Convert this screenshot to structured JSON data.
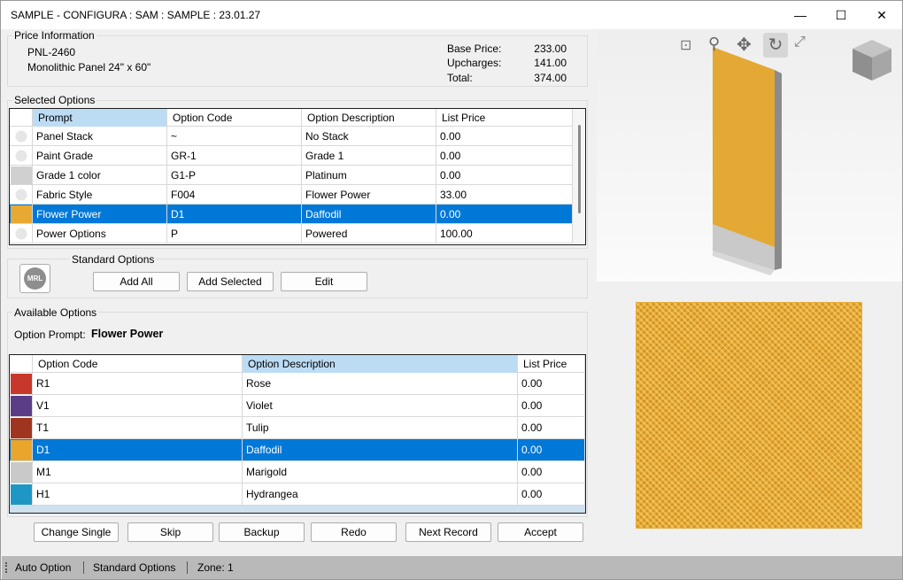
{
  "window": {
    "title": "SAMPLE - CONFIGURA : SAM : SAMPLE : 23.01.27",
    "minimize": "—",
    "maximize": "☐",
    "close": "✕"
  },
  "price_info": {
    "group_label": "Price Information",
    "part_number": "PNL-2460",
    "description": "Monolithic Panel 24\" x 60\"",
    "base_price_label": "Base Price:",
    "base_price": "233.00",
    "upcharges_label": "Upcharges:",
    "upcharges": "141.00",
    "total_label": "Total:",
    "total": "374.00"
  },
  "selected_options": {
    "group_label": "Selected Options",
    "columns": [
      "Prompt",
      "Option Code",
      "Option Description",
      "List Price"
    ],
    "rows": [
      {
        "prompt": "Panel Stack",
        "code": "~",
        "desc": "No Stack",
        "price": "0.00",
        "icon": "option-icon"
      },
      {
        "prompt": "Paint Grade",
        "code": "GR-1",
        "desc": "Grade 1",
        "price": "0.00",
        "icon": "option-icon"
      },
      {
        "prompt": "Grade 1 color",
        "code": "G1-P",
        "desc": "Platinum",
        "price": "0.00",
        "icon": "color-swatch"
      },
      {
        "prompt": "Fabric Style",
        "code": "F004",
        "desc": "Flower Power",
        "price": "33.00",
        "icon": "option-icon"
      },
      {
        "prompt": "Flower Power",
        "code": "D1",
        "desc": "Daffodil",
        "price": "0.00",
        "icon": "fabric-swatch"
      },
      {
        "prompt": "Power Options",
        "code": "P",
        "desc": "Powered",
        "price": "100.00",
        "icon": "power-icon"
      }
    ]
  },
  "standard_options": {
    "group_label": "Standard Options",
    "logo_text": "MRL",
    "add_all": "Add All",
    "add_selected": "Add Selected",
    "edit": "Edit"
  },
  "available_options": {
    "group_label": "Available Options",
    "prompt_label": "Option Prompt:",
    "prompt_value": "Flower Power",
    "columns": [
      "Option Code",
      "Option Description",
      "List Price"
    ],
    "rows": [
      {
        "code": "R1",
        "desc": "Rose",
        "price": "0.00",
        "color": "#c8382a"
      },
      {
        "code": "V1",
        "desc": "Violet",
        "price": "0.00",
        "color": "#5a3d86"
      },
      {
        "code": "T1",
        "desc": "Tulip",
        "price": "0.00",
        "color": "#a0351f"
      },
      {
        "code": "D1",
        "desc": "Daffodil",
        "price": "0.00",
        "color": "#e9a52c"
      },
      {
        "code": "M1",
        "desc": "Marigold",
        "price": "0.00",
        "color": "#c9c9c9"
      },
      {
        "code": "H1",
        "desc": "Hydrangea",
        "price": "0.00",
        "color": "#1f97c4"
      }
    ]
  },
  "actions": {
    "change_single": "Change Single",
    "skip": "Skip",
    "backup": "Backup",
    "redo": "Redo",
    "next_record": "Next Record",
    "accept": "Accept"
  },
  "status": {
    "auto_option": "Auto Option",
    "standard_options": "Standard Options",
    "zone": "Zone: 1"
  },
  "colors": {
    "selection": "#0078d7",
    "header_selected": "#bcdcf4",
    "fabric": "#e8a932"
  }
}
